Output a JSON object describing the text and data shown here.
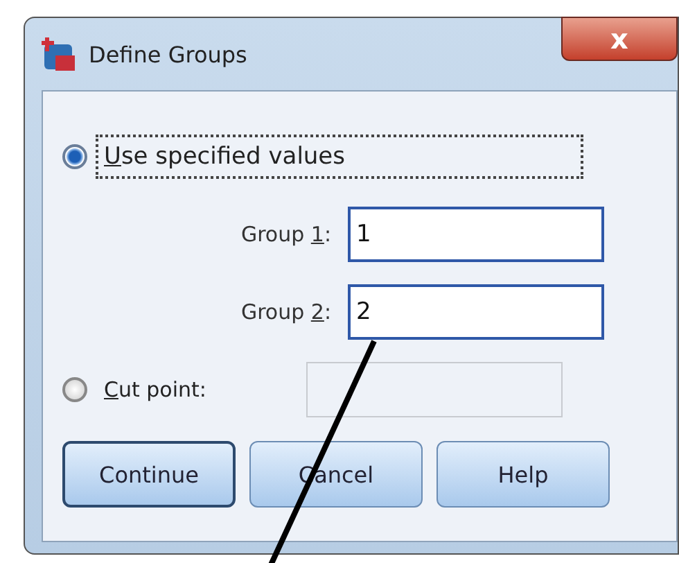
{
  "window": {
    "title": "Define Groups",
    "close": "x"
  },
  "options": [
    {
      "kind": "radio",
      "selected": true,
      "focused": true,
      "mnemonic": "U",
      "after": "se specified values"
    },
    {
      "kind": "field",
      "before": "Group ",
      "mnemonic": "1",
      "after": ":",
      "value": "1",
      "disabled": false
    },
    {
      "kind": "field",
      "before": "Group ",
      "mnemonic": "2",
      "after": ":",
      "value": "2",
      "disabled": false
    },
    {
      "kind": "radio-field",
      "selected": false,
      "focused": false,
      "mnemonic": "C",
      "after": "ut point:",
      "disabled": true
    }
  ],
  "buttons": [
    {
      "label": "Continue",
      "default": true
    },
    {
      "label": "Cancel",
      "default": false
    },
    {
      "label": "Help",
      "default": false
    }
  ]
}
